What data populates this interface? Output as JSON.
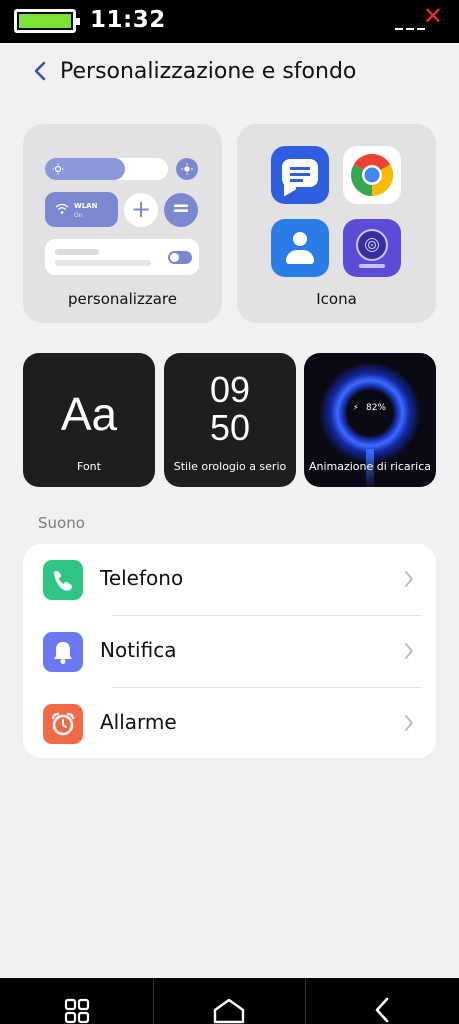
{
  "status_bar": {
    "time": "11:32"
  },
  "header": {
    "title": "Personalizzazione e sfondo"
  },
  "theme_cards": [
    {
      "label": "personalizzare",
      "preview": {
        "wlan_label": "WLAN",
        "wlan_status": "On"
      }
    },
    {
      "label": "Icona",
      "icons": [
        "messages-icon",
        "chrome-icon",
        "contacts-icon",
        "radio-icon"
      ]
    }
  ],
  "style_cards": [
    {
      "label": "Font",
      "preview": "Aa"
    },
    {
      "label": "Stile orologio a serio",
      "preview_hour": "09",
      "preview_minute": "50"
    },
    {
      "label": "Animazione di ricarica",
      "preview": "82%"
    }
  ],
  "sound_section": {
    "title": "Suono",
    "items": [
      {
        "label": "Telefono",
        "icon": "phone-icon",
        "color": "#2fc685"
      },
      {
        "label": "Notifica",
        "icon": "bell-icon",
        "color": "#6d79f3"
      },
      {
        "label": "Allarme",
        "icon": "alarm-icon",
        "color": "#f26948"
      }
    ]
  },
  "nav_bar": {
    "buttons": [
      "recent-apps-icon",
      "home-icon",
      "back-icon"
    ]
  }
}
